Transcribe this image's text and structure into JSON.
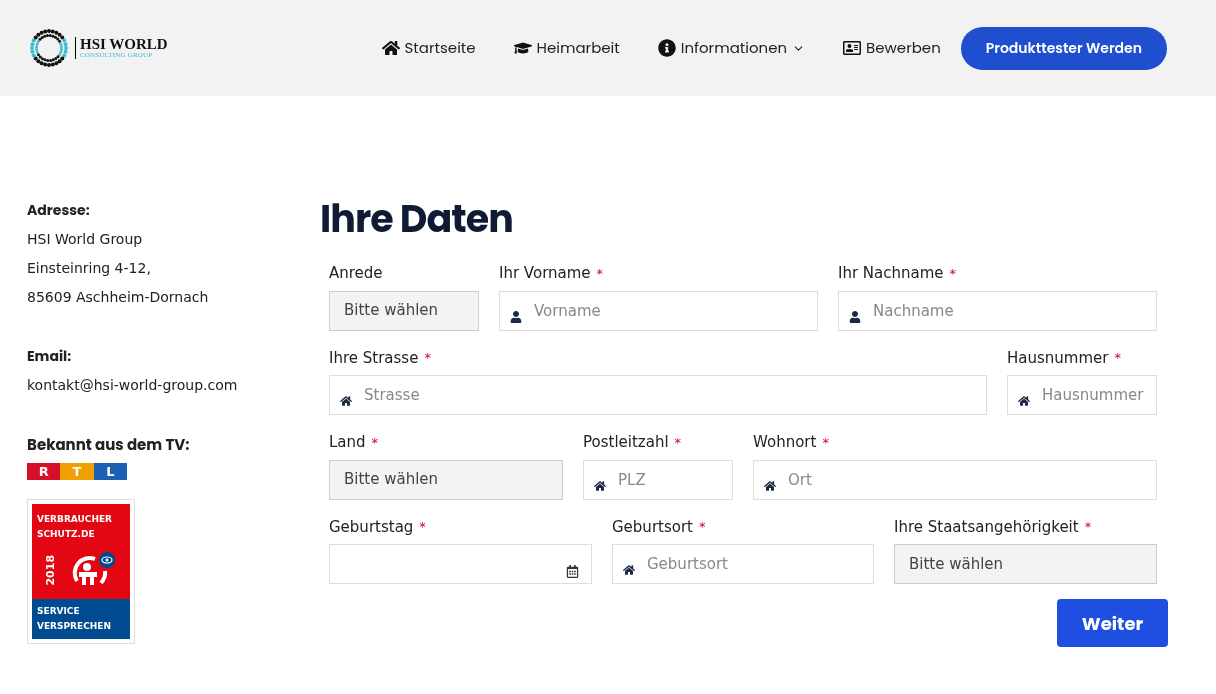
{
  "header": {
    "logo": {
      "title": "HSI WORLD",
      "subtitle": "CONSULTING GROUP"
    },
    "nav": [
      {
        "label": "Startseite",
        "dropdown": false
      },
      {
        "label": "Heimarbeit",
        "dropdown": false
      },
      {
        "label": "Informationen",
        "dropdown": true
      },
      {
        "label": "Bewerben",
        "dropdown": false
      }
    ],
    "cta": "Produkttester Werden"
  },
  "sidebar": {
    "address_label": "Adresse:",
    "address_lines": [
      "HSI World Group",
      "Einsteinring 4-12,",
      "85609 Aschheim-Dornach"
    ],
    "email_label": "Email:",
    "email": "kontakt@hsi-world-group.com",
    "tv_label": "Bekannt aus dem TV:",
    "tv_logo": [
      "R",
      "T",
      "L"
    ],
    "seal": {
      "top_lines": [
        "VERBRAUCHER",
        "SCHUTZ.DE"
      ],
      "year": "2018",
      "bottom_lines": [
        "SERVICE",
        "VERSPRECHEN"
      ]
    }
  },
  "form": {
    "title": "Ihre Daten",
    "rows": [
      [
        {
          "label": "Anrede",
          "kind": "select",
          "value": "Bitte wählen"
        },
        {
          "label": "Ihr Vorname",
          "required_mark": "*",
          "kind": "name",
          "placeholder": "Vorname"
        },
        {
          "label": "Ihr Nachname",
          "required_mark": "*",
          "kind": "name",
          "placeholder": "Nachname"
        }
      ],
      [
        {
          "label": "Ihre Strasse",
          "required_mark": "*",
          "kind": "address",
          "placeholder": "Strasse"
        },
        {
          "label": "Hausnummer",
          "required_mark": "*",
          "kind": "address",
          "placeholder": "Hausnummer"
        }
      ],
      [
        {
          "label": "Land",
          "required_mark": "*",
          "kind": "select",
          "value": "Bitte wählen"
        },
        {
          "label": "Postleitzahl",
          "required_mark": "*",
          "kind": "address",
          "placeholder": "PLZ"
        },
        {
          "label": "Wohnort",
          "required_mark": "*",
          "kind": "address",
          "placeholder": "Ort"
        }
      ],
      [
        {
          "label": "Geburtstag",
          "required_mark": "*",
          "kind": "date"
        },
        {
          "label": "Geburtsort",
          "required_mark": "*",
          "kind": "address",
          "placeholder": "Geburtsort"
        },
        {
          "label": "Ihre Staatsangehörigkeit",
          "required_mark": "*",
          "kind": "select",
          "value": "Bitte wählen"
        }
      ]
    ],
    "submit": "Weiter"
  }
}
